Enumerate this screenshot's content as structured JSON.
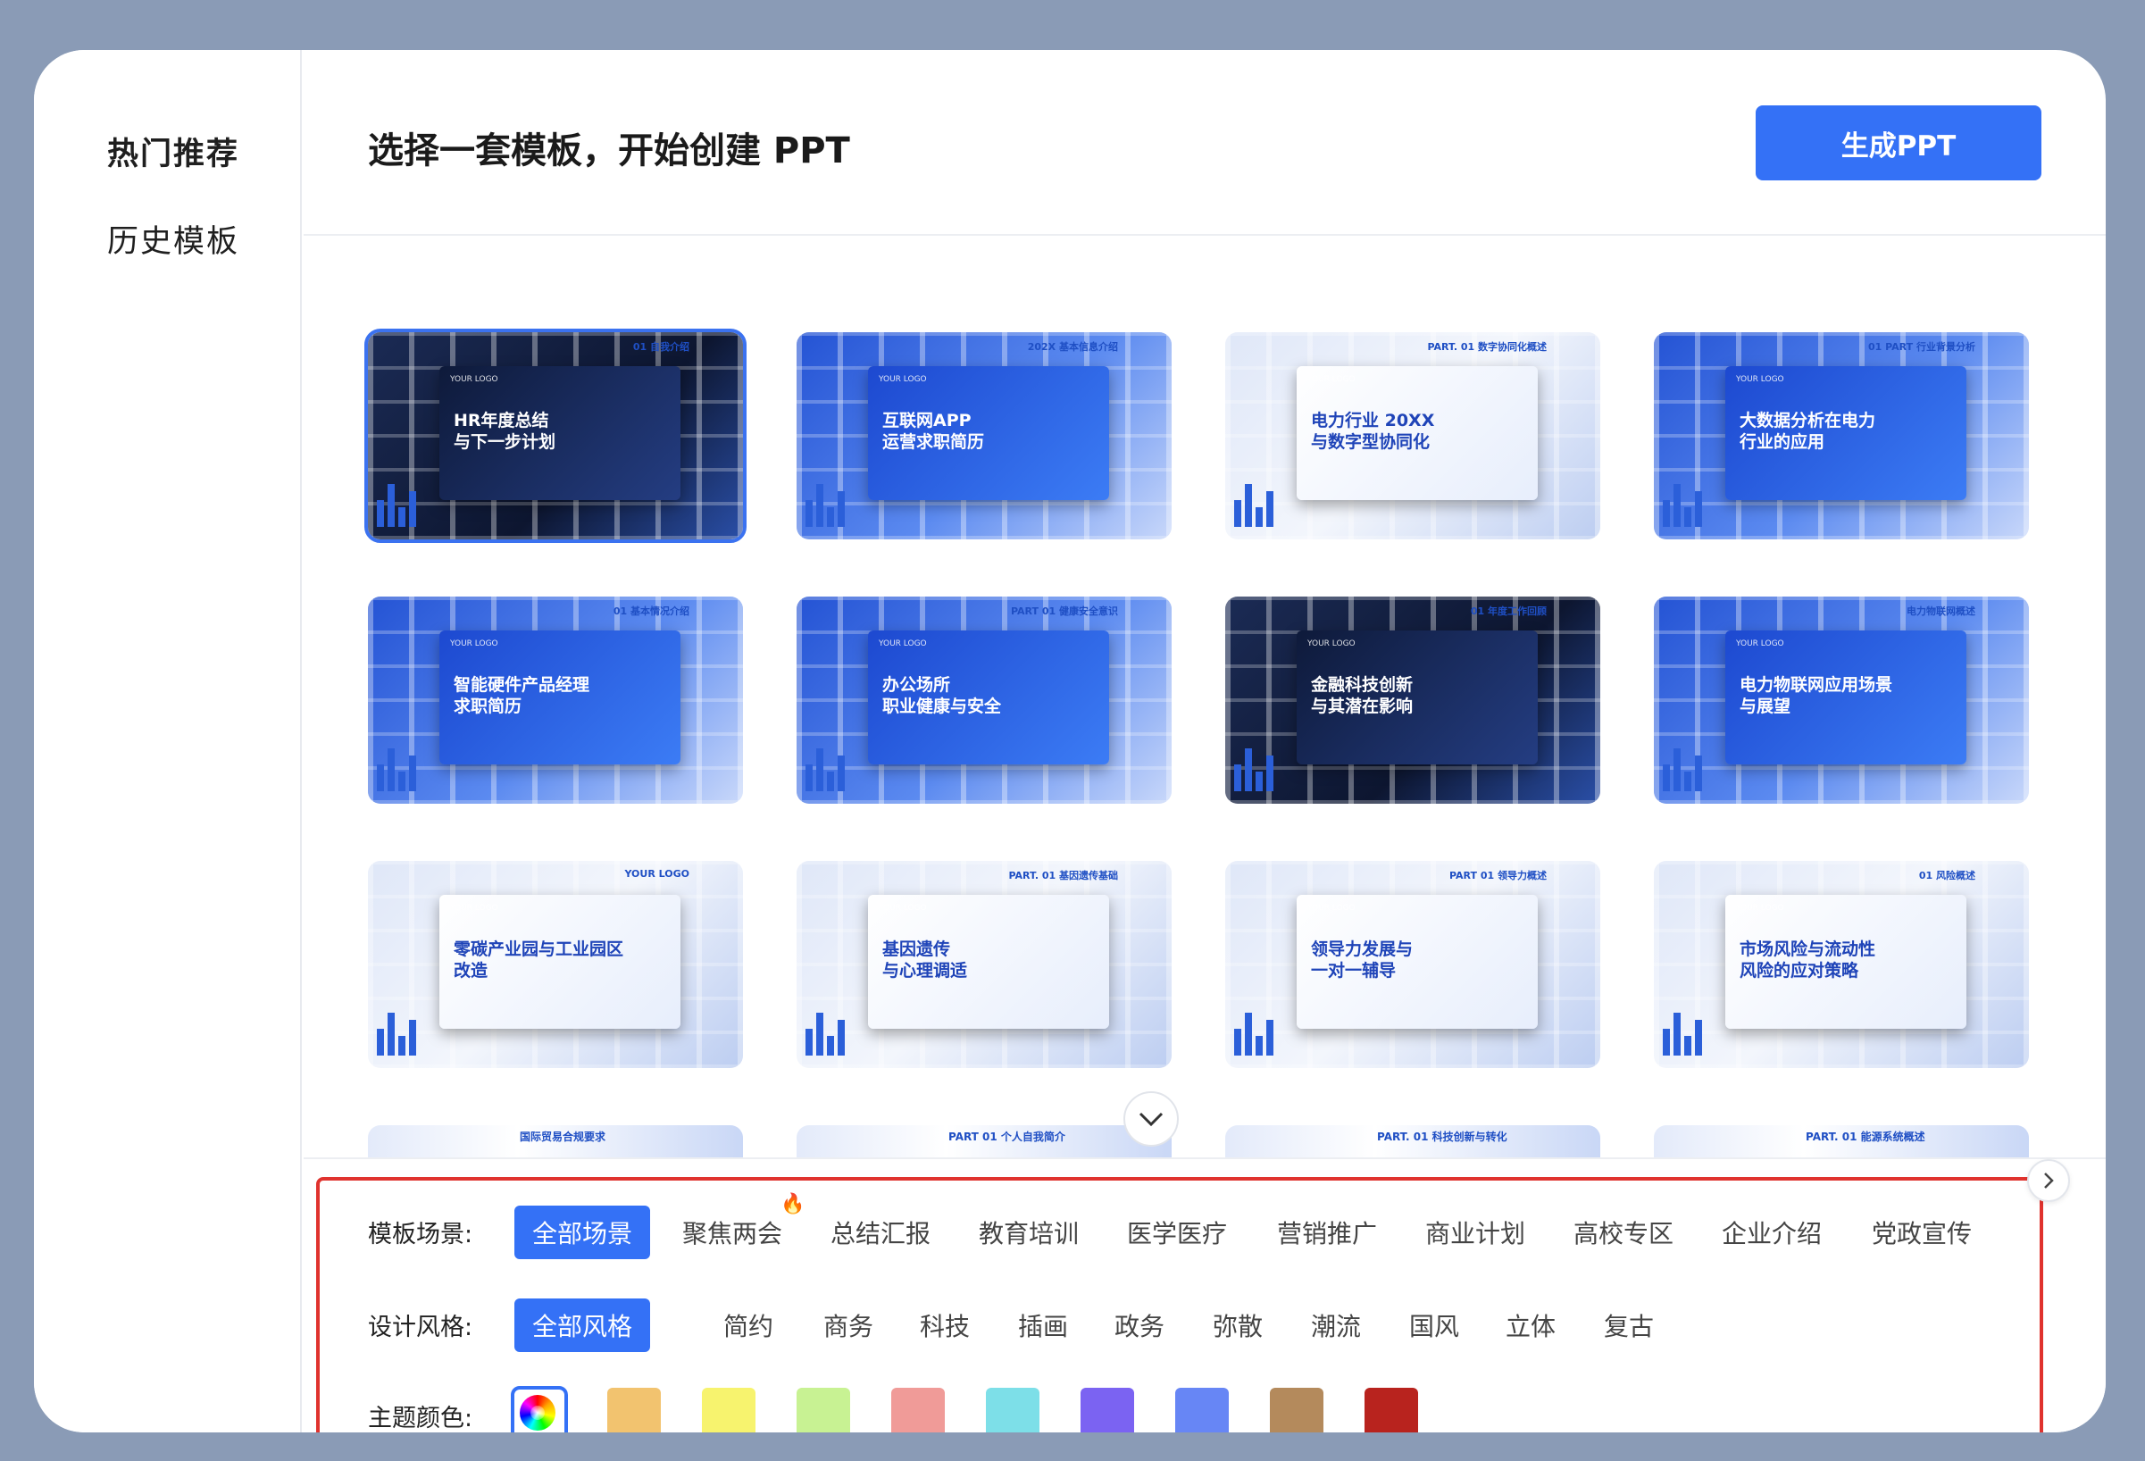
{
  "sidebar": {
    "items": [
      {
        "label": "热门推荐",
        "active": true
      },
      {
        "label": "历史模板",
        "active": false
      }
    ]
  },
  "header": {
    "title": "选择一套模板，开始创建 PPT",
    "generate_label": "生成PPT"
  },
  "templates": [
    {
      "title": "HR年度总结\n与下一步计划",
      "part": "01 自我介绍",
      "logo": "YOUR LOGO",
      "theme": "dark"
    },
    {
      "title": "互联网APP\n运营求职简历",
      "part": "202X 基本信息介绍",
      "logo": "YOUR LOGO",
      "theme": "blue"
    },
    {
      "title": "电力行业 20XX\n与数字型协同化",
      "part": "PART. 01 数字协同化概述",
      "logo": "YOUR LOGO",
      "theme": "light"
    },
    {
      "title": "大数据分析在电力\n行业的应用",
      "part": "01 PART 行业背景分析",
      "logo": "YOUR LOGO",
      "theme": "blue"
    },
    {
      "title": "智能硬件产品经理\n求职简历",
      "part": "01 基本情况介绍",
      "logo": "YOUR LOGO",
      "theme": "blue"
    },
    {
      "title": "办公场所\n职业健康与安全",
      "part": "PART 01 健康安全意识",
      "logo": "YOUR LOGO",
      "theme": "blue"
    },
    {
      "title": "金融科技创新\n与其潜在影响",
      "part": "01 年度工作回顾",
      "logo": "YOUR LOGO",
      "theme": "dark"
    },
    {
      "title": "电力物联网应用场景\n与展望",
      "part": "电力物联网概述",
      "logo": "YOUR LOGO",
      "theme": "blue"
    },
    {
      "title": "零碳产业园与工业园区改造",
      "part": "YOUR LOGO",
      "logo": "YOUR LOGO",
      "theme": "light"
    },
    {
      "title": "基因遗传\n与心理调适",
      "part": "PART. 01 基因遗传基础",
      "logo": "YOUR LOGO",
      "theme": "light"
    },
    {
      "title": "领导力发展与\n一对一辅导",
      "part": "PART 01 领导力概述",
      "logo": "YOUR LOGO",
      "theme": "light"
    },
    {
      "title": "市场风险与流动性\n风险的应对策略",
      "part": "01 风险概述",
      "logo": "YOUR LOGO",
      "theme": "light"
    }
  ],
  "partial_templates": [
    "国际贸易合规要求",
    "PART 01 个人自我简介",
    "PART. 01 科技创新与转化",
    "PART. 01 能源系统概述"
  ],
  "filters": {
    "scene": {
      "label": "模板场景:",
      "options": [
        "全部场景",
        "聚焦两会",
        "总结汇报",
        "教育培训",
        "医学医疗",
        "营销推广",
        "商业计划",
        "高校专区",
        "企业介绍",
        "党政宣传"
      ],
      "selected": "全部场景",
      "hot": "聚焦两会"
    },
    "style": {
      "label": "设计风格:",
      "options": [
        "全部风格",
        "简约",
        "商务",
        "科技",
        "插画",
        "政务",
        "弥散",
        "潮流",
        "国风",
        "立体",
        "复古"
      ],
      "selected": "全部风格"
    },
    "color": {
      "label": "主题颜色:",
      "selected": "all",
      "swatches": [
        "#f2c36f",
        "#f7f36e",
        "#c8f293",
        "#f09b98",
        "#7ddfe8",
        "#7b63f2",
        "#6786f5",
        "#b48a5c",
        "#b8231e"
      ]
    }
  }
}
